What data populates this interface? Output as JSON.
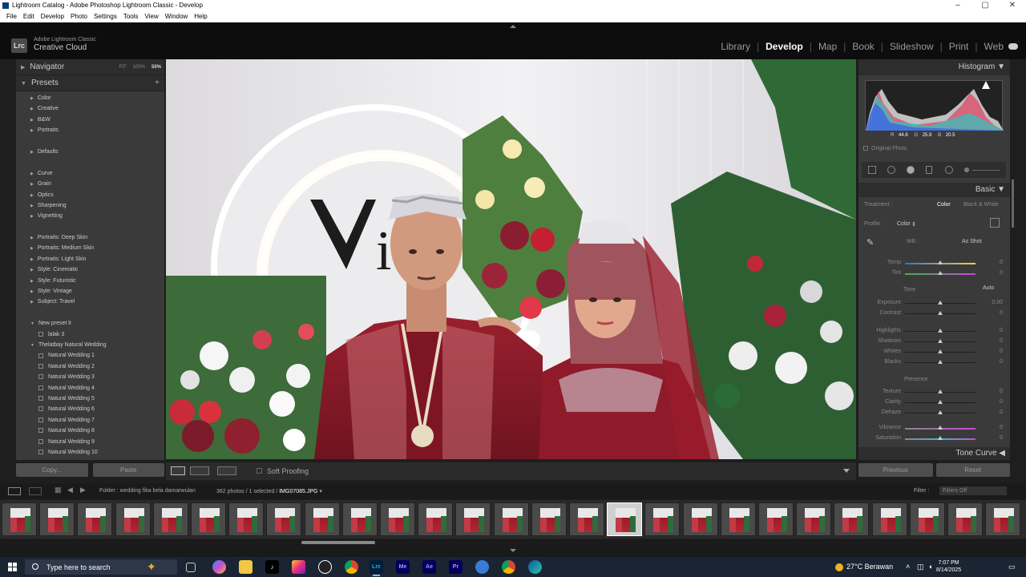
{
  "window": {
    "title": "Lightroom Catalog - Adobe Photoshop Lightroom Classic - Develop",
    "controls": [
      "–",
      "▢",
      "✕"
    ]
  },
  "menu": [
    "File",
    "Edit",
    "Develop",
    "Photo",
    "Settings",
    "Tools",
    "View",
    "Window",
    "Help"
  ],
  "brand": {
    "logo": "Lrc",
    "line1": "Adobe Lightroom Classic",
    "line2": "Creative Cloud"
  },
  "modules": [
    {
      "label": "Library",
      "active": false
    },
    {
      "label": "Develop",
      "active": true
    },
    {
      "label": "Map",
      "active": false
    },
    {
      "label": "Book",
      "active": false
    },
    {
      "label": "Slideshow",
      "active": false
    },
    {
      "label": "Print",
      "active": false
    },
    {
      "label": "Web",
      "active": false
    }
  ],
  "navigator": {
    "title": "Navigator",
    "zoom": [
      "FIT",
      "100%",
      "50%"
    ],
    "zoom_selected": "50%"
  },
  "presets": {
    "title": "Presets",
    "items": [
      {
        "label": "Color",
        "kind": "group"
      },
      {
        "label": "Creative",
        "kind": "group"
      },
      {
        "label": "B&W",
        "kind": "group"
      },
      {
        "label": "Portraits",
        "kind": "group"
      },
      {
        "label": "",
        "kind": "gap"
      },
      {
        "label": "Defaults",
        "kind": "group"
      },
      {
        "label": "",
        "kind": "gap"
      },
      {
        "label": "Curve",
        "kind": "group"
      },
      {
        "label": "Grain",
        "kind": "group"
      },
      {
        "label": "Optics",
        "kind": "group"
      },
      {
        "label": "Sharpening",
        "kind": "group"
      },
      {
        "label": "Vignetting",
        "kind": "group"
      },
      {
        "label": "",
        "kind": "gap"
      },
      {
        "label": "Portraits: Deep Skin",
        "kind": "group"
      },
      {
        "label": "Portraits: Medium Skin",
        "kind": "group"
      },
      {
        "label": "Portraits: Light Skin",
        "kind": "group"
      },
      {
        "label": "Style: Cinematic",
        "kind": "group"
      },
      {
        "label": "Style: Futuristic",
        "kind": "group"
      },
      {
        "label": "Style: Vintage",
        "kind": "group"
      },
      {
        "label": "Subject: Travel",
        "kind": "group"
      },
      {
        "label": "",
        "kind": "gap"
      },
      {
        "label": "New preset lr",
        "kind": "open"
      },
      {
        "label": "lalak 3",
        "kind": "preset"
      },
      {
        "label": "Thelatbay Natural Wedding",
        "kind": "open"
      },
      {
        "label": "Natural Wedding 1",
        "kind": "preset"
      },
      {
        "label": "Natural Wedding 2",
        "kind": "preset"
      },
      {
        "label": "Natural Wedding 3",
        "kind": "preset"
      },
      {
        "label": "Natural Wedding 4",
        "kind": "preset"
      },
      {
        "label": "Natural Wedding 5",
        "kind": "preset"
      },
      {
        "label": "Natural Wedding 6",
        "kind": "preset"
      },
      {
        "label": "Natural Wedding 7",
        "kind": "preset"
      },
      {
        "label": "Natural Wedding 8",
        "kind": "preset"
      },
      {
        "label": "Natural Wedding 9",
        "kind": "preset"
      },
      {
        "label": "Natural Wedding 10",
        "kind": "preset"
      }
    ]
  },
  "left_buttons": {
    "copy": "Copy...",
    "paste": "Paste"
  },
  "toolbar": {
    "soft_proofing": "Soft Proofing"
  },
  "histogram": {
    "title": "Histogram",
    "r_label": "R",
    "r": "44.6",
    "g_label": "G",
    "g": "25.9",
    "b_label": "B",
    "b": "20.5",
    "original_photo": "Original Photo"
  },
  "basic": {
    "title": "Basic",
    "treatment_label": "Treatment :",
    "treatment_color": "Color",
    "treatment_bw": "Black & White",
    "profile_label": "Profile :",
    "profile_value": "Color",
    "wb_label": "WB :",
    "wb_value": "As Shot",
    "tone_label": "Tone",
    "tone_auto": "Auto",
    "presence_label": "Presence",
    "sliders": [
      {
        "label": "Temp",
        "value": "0",
        "level": 0.5
      },
      {
        "label": "Tint",
        "value": "0",
        "level": 0.5
      },
      {
        "label": "Exposure",
        "value": "0.00",
        "level": 0.5
      },
      {
        "label": "Contrast",
        "value": "0",
        "level": 0.5
      },
      {
        "label": "Highlights",
        "value": "0",
        "level": 0.5
      },
      {
        "label": "Shadows",
        "value": "0",
        "level": 0.5
      },
      {
        "label": "Whites",
        "value": "0",
        "level": 0.5
      },
      {
        "label": "Blacks",
        "value": "0",
        "level": 0.5
      },
      {
        "label": "Texture",
        "value": "0",
        "level": 0.5
      },
      {
        "label": "Clarity",
        "value": "0",
        "level": 0.5
      },
      {
        "label": "Dehaze",
        "value": "0",
        "level": 0.5
      },
      {
        "label": "Vibrance",
        "value": "0",
        "level": 0.5
      },
      {
        "label": "Saturation",
        "value": "0",
        "level": 0.5
      }
    ]
  },
  "tone_curve": {
    "title": "Tone Curve"
  },
  "right_buttons": {
    "previous": "Previous",
    "reset": "Reset"
  },
  "filmstrip_bar": {
    "folder": "Folder : wedding fika bela damarwulan",
    "count": "362 photos / 1 selected /",
    "file": "IMG07085.JPG",
    "filter_label": "Filter :",
    "filter_value": "Filters Off"
  },
  "filmstrip": {
    "thumb_count": 27,
    "selected_index": 16
  },
  "taskbar": {
    "search_placeholder": "Type here to search",
    "apps": [
      "task-view",
      "copilot",
      "file-explorer",
      "tiktok",
      "instagram",
      "capcut",
      "chrome",
      "lightroom",
      "media-encoder",
      "after-effects",
      "premiere",
      "generic",
      "chrome-2",
      "edge"
    ],
    "weather": "27°C Berawan",
    "time": "7:07 PM",
    "date": "8/14/2025"
  }
}
